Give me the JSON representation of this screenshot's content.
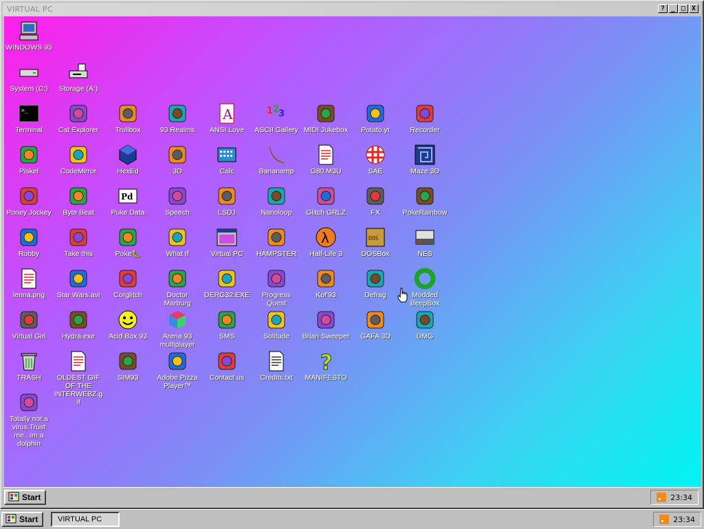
{
  "window": {
    "title": "VIRTUAL PC",
    "help_label": "?",
    "min_label": "_",
    "max_label": "□",
    "close_label": "X"
  },
  "desktop_icons": [
    {
      "name": "windows-93",
      "label": "WINDOWS 93",
      "icon": "computer-icon"
    },
    {
      "name": "system-c",
      "label": "System (C:)",
      "icon": "hard-drive-icon"
    },
    {
      "name": "storage-a",
      "label": "Storage (A:)",
      "icon": "floppy-drive-icon"
    },
    {
      "name": "terminal",
      "label": "Terminal",
      "icon": "terminal-icon"
    },
    {
      "name": "cat-explorer",
      "label": "Cat Explorer",
      "icon": "globe-cat-icon"
    },
    {
      "name": "trollbox",
      "label": "Trollbox",
      "icon": "chat-icon"
    },
    {
      "name": "93-realms",
      "label": "93 Realms",
      "icon": "knight-icon"
    },
    {
      "name": "ansi-love",
      "label": "ANSI Love",
      "icon": "letter-a-icon"
    },
    {
      "name": "ascii-gallery",
      "label": "ASCII Gallery",
      "icon": "numbers-icon"
    },
    {
      "name": "midi-jukebox",
      "label": "MIDI Jukebox",
      "icon": "piano-icon"
    },
    {
      "name": "potato-yt",
      "label": "Potato.yt",
      "icon": "potato-icon"
    },
    {
      "name": "recorder",
      "label": "Recorder",
      "icon": "microphone-icon"
    },
    {
      "name": "piskel",
      "label": "Piskel",
      "icon": "palette-icon"
    },
    {
      "name": "codemirror",
      "label": "CodeMirror",
      "icon": "codemirror-icon"
    },
    {
      "name": "hexed",
      "label": "HexEd",
      "icon": "hexagon-icon"
    },
    {
      "name": "3d",
      "label": "3D",
      "icon": "teapot-icon"
    },
    {
      "name": "calc",
      "label": "Calc",
      "icon": "calculator-icon"
    },
    {
      "name": "bananamp",
      "label": "Bananamp",
      "icon": "banana-icon"
    },
    {
      "name": "g80-m3u",
      "label": "G80.M3U",
      "icon": "audio-file-icon"
    },
    {
      "name": "sae",
      "label": "SAE",
      "icon": "ball-icon"
    },
    {
      "name": "maze-3d",
      "label": "Maze 3D",
      "icon": "maze-icon"
    },
    {
      "name": "poney-jockey",
      "label": "Poney Jockey",
      "icon": "pony-icon"
    },
    {
      "name": "byte-beat",
      "label": "Byte Beat",
      "icon": "byte-beat-icon"
    },
    {
      "name": "puke-data",
      "label": "Puke Data",
      "icon": "pd-icon"
    },
    {
      "name": "speech",
      "label": "Speech",
      "icon": "face-icon"
    },
    {
      "name": "lsdj",
      "label": "LSDJ",
      "icon": "gameboy-icon"
    },
    {
      "name": "nanoloop",
      "label": "Nanoloop",
      "icon": "wave-icon"
    },
    {
      "name": "glitch-grlz",
      "label": "Glitch GRLZ",
      "icon": "lips-icon"
    },
    {
      "name": "fx",
      "label": "FX",
      "icon": "atom-icon"
    },
    {
      "name": "pokerainbow",
      "label": "PokeRainbow",
      "icon": "pokemon-trainer-icon"
    },
    {
      "name": "robby",
      "label": "Robby",
      "icon": "stick-figure-icon"
    },
    {
      "name": "take-this",
      "label": "Take this",
      "icon": "pixel-man-icon"
    },
    {
      "name": "pokedex",
      "label": "Poke🐛",
      "icon": "pokeball-icon"
    },
    {
      "name": "what-if",
      "label": "What If",
      "icon": "matrix-icon"
    },
    {
      "name": "virtual-pc",
      "label": "Virtual PC",
      "icon": "window-icon"
    },
    {
      "name": "hampster",
      "label": "HAMPSTER",
      "icon": "hamster-icon"
    },
    {
      "name": "half-life-3",
      "label": "Half-Life 3",
      "icon": "lambda-icon"
    },
    {
      "name": "dosbox",
      "label": "DOSBox",
      "icon": "box-icon"
    },
    {
      "name": "nes",
      "label": "NES",
      "icon": "nes-icon"
    },
    {
      "name": "lenna-png",
      "label": "lenna.png",
      "icon": "image-file-icon"
    },
    {
      "name": "star-wars-avi",
      "label": "Star Wars.avi",
      "icon": "yoda-icon"
    },
    {
      "name": "corglitch",
      "label": "Corglitch",
      "icon": "corgi-icon"
    },
    {
      "name": "doctor-marburg",
      "label": "Doctor Marburg",
      "icon": "doctor-icon"
    },
    {
      "name": "derg32-exe",
      "label": "DERG32.EXE",
      "icon": "monitor-face-icon"
    },
    {
      "name": "progress-quest",
      "label": "Progress Quest",
      "icon": "crossed-swords-icon"
    },
    {
      "name": "kof93",
      "label": "Kof'93",
      "icon": "fighter-icon"
    },
    {
      "name": "defrag",
      "label": "Defrag",
      "icon": "defrag-icon"
    },
    {
      "name": "modded-beepbox",
      "label": "Modded BeepBox",
      "icon": "green-ring-icon"
    },
    {
      "name": "virtual-girl",
      "label": "Virtual Girl",
      "icon": "girl-icon"
    },
    {
      "name": "hydra-exe",
      "label": "Hydra.exe",
      "icon": "hydra-icon"
    },
    {
      "name": "acid-box-93",
      "label": "Acid Box 93",
      "icon": "smiley-icon"
    },
    {
      "name": "arena-93",
      "label": "Arena 93 multiplayer",
      "icon": "cube-icon"
    },
    {
      "name": "sms",
      "label": "SMS",
      "icon": "console-icon"
    },
    {
      "name": "solitude",
      "label": "Solitude",
      "icon": "bottle-icon"
    },
    {
      "name": "brian-sweeper",
      "label": "Brian Sweeper",
      "icon": "mine-icon"
    },
    {
      "name": "gafa-3d",
      "label": "GAFA 3D",
      "icon": "doom-face-icon"
    },
    {
      "name": "dmg",
      "label": "DMG",
      "icon": "disk-drive-icon"
    },
    {
      "name": "trash",
      "label": "TRASH",
      "icon": "trash-icon"
    },
    {
      "name": "oldest-gif",
      "label": "OLDEST GIF OF THE INTERWEBZ.gif",
      "icon": "gif-file-icon"
    },
    {
      "name": "sim93",
      "label": "SIM93",
      "icon": "book-icon"
    },
    {
      "name": "adobe-pizza",
      "label": "Adobe Pizza Player™",
      "icon": "pizza-icon"
    },
    {
      "name": "contact-us",
      "label": "Contact us",
      "icon": "contact-icon"
    },
    {
      "name": "credits-txt",
      "label": "Credits.txt",
      "icon": "text-file-icon"
    },
    {
      "name": "manifesto",
      "label": "MANIFESTO",
      "icon": "question-mark-icon"
    },
    {
      "name": "dolphin",
      "label": "Totally not a virus.Trust me...im a dolphin",
      "icon": "dolphin-icon"
    }
  ],
  "inner_taskbar": {
    "start_label": "Start",
    "clock": "23:34"
  },
  "outer_taskbar": {
    "start_label": "Start",
    "task_label": "VIRTUAL PC",
    "clock": "23:34"
  }
}
